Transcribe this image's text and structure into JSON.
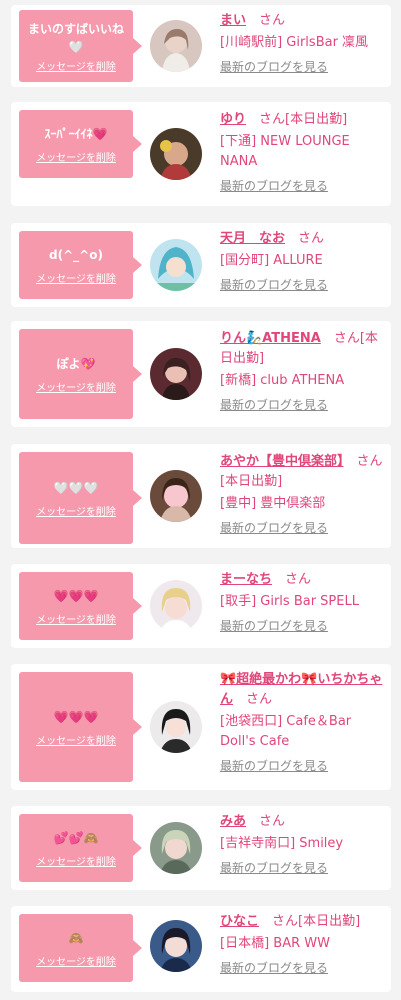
{
  "common": {
    "delete_label": "メッセージを削除",
    "blog_label": "最新のブログを見る",
    "san": "さん"
  },
  "colors": {
    "bubble": "#f799ad",
    "accent": "#e0467a",
    "muted": "#8a8a8a",
    "background": "#f3f3f3"
  },
  "messages": [
    {
      "message_text": "まいのすばいいね",
      "message_emoji": "🤍",
      "name": "まい",
      "suffix": "",
      "shop": "[川崎駅前] GirlsBar 凜風",
      "avatar_icon": "avatar-photo"
    },
    {
      "message_text": "ｽｰﾊﾟｰｲｲﾈ",
      "message_emoji": "💗",
      "name": "ゆり",
      "suffix": "[本日出勤]",
      "shop": "[下通] NEW LOUNGE NANA",
      "avatar_icon": "avatar-photo"
    },
    {
      "message_text": "d(^_^o)",
      "message_emoji": "",
      "name": "天月　なお",
      "suffix": "",
      "shop": "[国分町] ALLURE",
      "avatar_icon": "avatar-photo"
    },
    {
      "message_text": "ぽよ",
      "message_emoji": "💖",
      "name": "りん🧞ATHENA",
      "suffix": "[本日出勤]",
      "shop": "[新橋] club ATHENA",
      "avatar_icon": "avatar-photo"
    },
    {
      "message_text": "",
      "message_emoji": "🤍🤍🤍",
      "name": "あやか【豊中倶楽部】",
      "suffix": "[本日出勤]",
      "shop": "[豊中] 豊中倶楽部",
      "avatar_icon": "avatar-photo"
    },
    {
      "message_text": "",
      "message_emoji": "💗💗💗",
      "name": "まーなち",
      "suffix": "",
      "shop": "[取手] Girls Bar SPELL",
      "avatar_icon": "avatar-photo"
    },
    {
      "message_text": "",
      "message_emoji": "💗💗💗",
      "name": "🎀超絶最かわ🎀いちかちゃん",
      "suffix": "",
      "shop": "[池袋西口] Cafe＆Bar Doll's Cafe",
      "avatar_icon": "avatar-photo"
    },
    {
      "message_text": "",
      "message_emoji": "💕💕🙈",
      "name": "みあ",
      "suffix": "",
      "shop": "[吉祥寺南口] Smiley",
      "avatar_icon": "avatar-photo"
    },
    {
      "message_text": "",
      "message_emoji": "🙈",
      "name": "ひなこ",
      "suffix": "[本日出勤]",
      "shop": "[日本橋] BAR WW",
      "avatar_icon": "avatar-photo"
    }
  ]
}
